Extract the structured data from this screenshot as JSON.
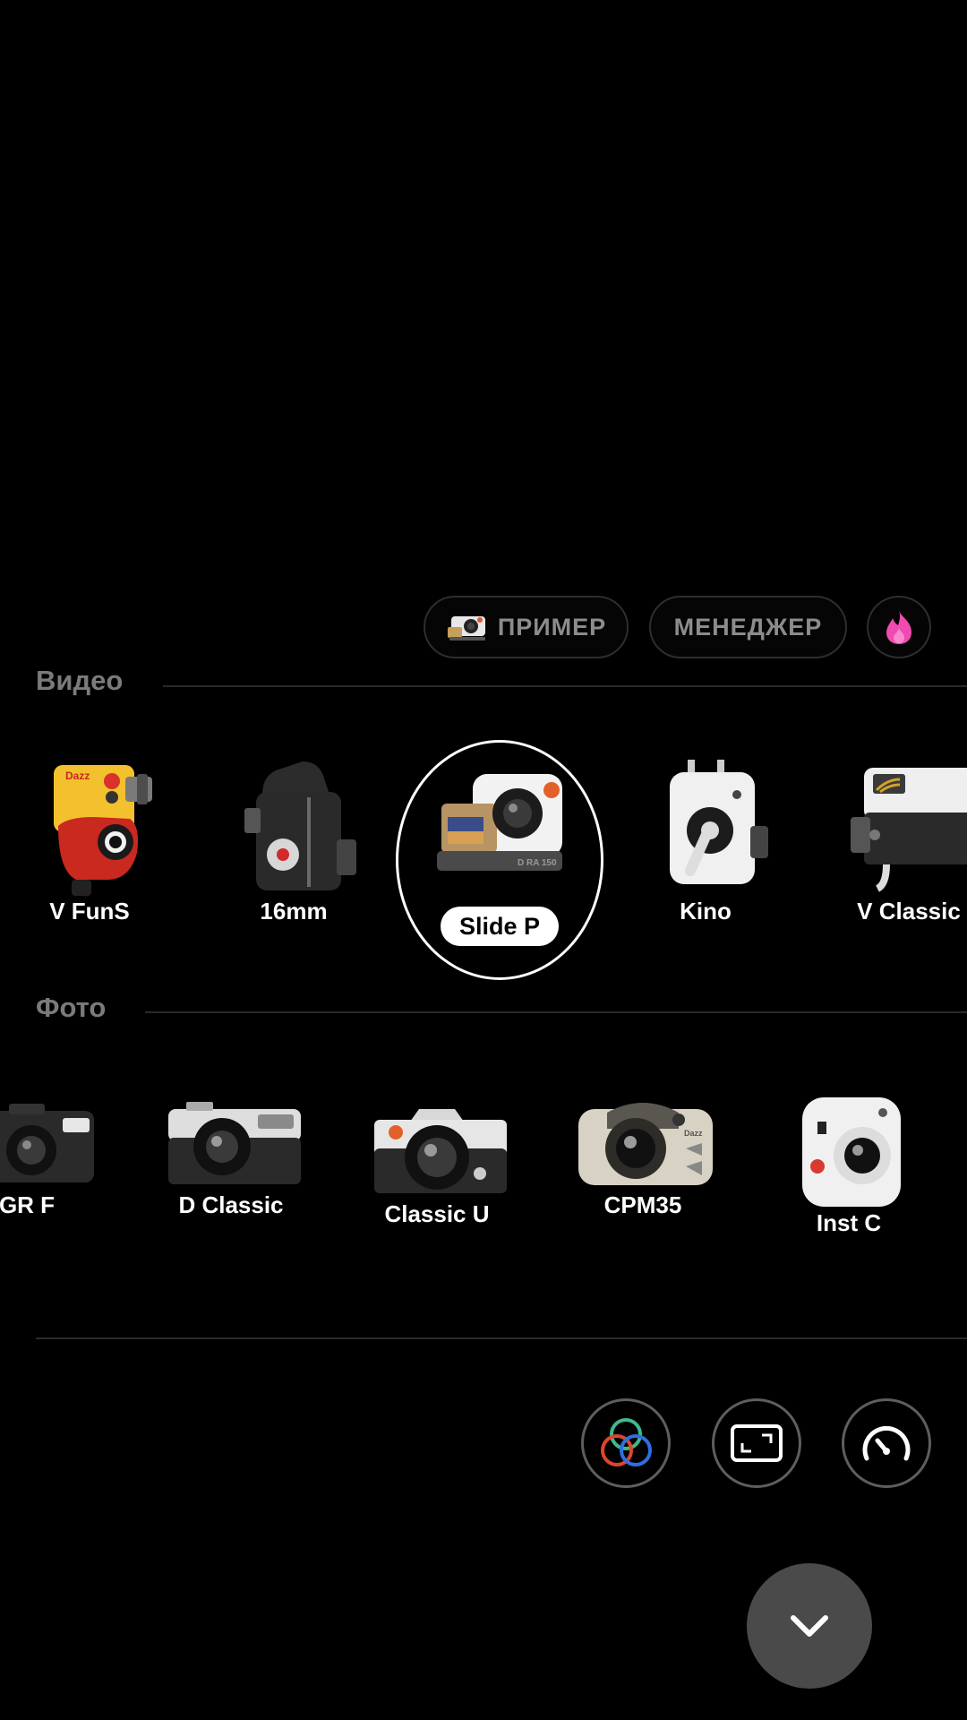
{
  "top_pills": {
    "sample_label": "ПРИМЕР",
    "manager_label": "МЕНЕДЖЕР",
    "trending_icon": "fire-icon"
  },
  "video_section": {
    "title": "Видео",
    "cameras": [
      {
        "label": "V FunS",
        "icon": "camcorder-yellow-icon",
        "brand": "Dazz"
      },
      {
        "label": "16mm",
        "icon": "film-camera-16mm-icon"
      },
      {
        "label": "Slide P",
        "icon": "slide-projector-icon",
        "selected": true,
        "model_text": "D RA 150"
      },
      {
        "label": "Kino",
        "icon": "kino-camera-icon"
      },
      {
        "label": "V Classic",
        "icon": "v-classic-camcorder-icon"
      }
    ]
  },
  "photo_section": {
    "title": "Фото",
    "cameras": [
      {
        "label": "GR F",
        "icon": "gr-f-camera-icon"
      },
      {
        "label": "D Classic",
        "icon": "d-classic-camera-icon"
      },
      {
        "label": "Classic U",
        "icon": "classic-u-camera-icon"
      },
      {
        "label": "CPM35",
        "icon": "cpm35-camera-icon",
        "brand": "Dazz"
      },
      {
        "label": "Inst C",
        "icon": "instant-camera-icon"
      }
    ]
  },
  "bottom_tools": [
    {
      "icon": "color-filter-icon"
    },
    {
      "icon": "aspect-ratio-icon"
    },
    {
      "icon": "speed-gauge-icon"
    }
  ],
  "collapse_icon": "chevron-down-icon",
  "colors": {
    "background": "#000000",
    "pill_text": "#8c8c8c",
    "section_title": "#7b7b7b",
    "fire_pink": "#f04bb0"
  }
}
